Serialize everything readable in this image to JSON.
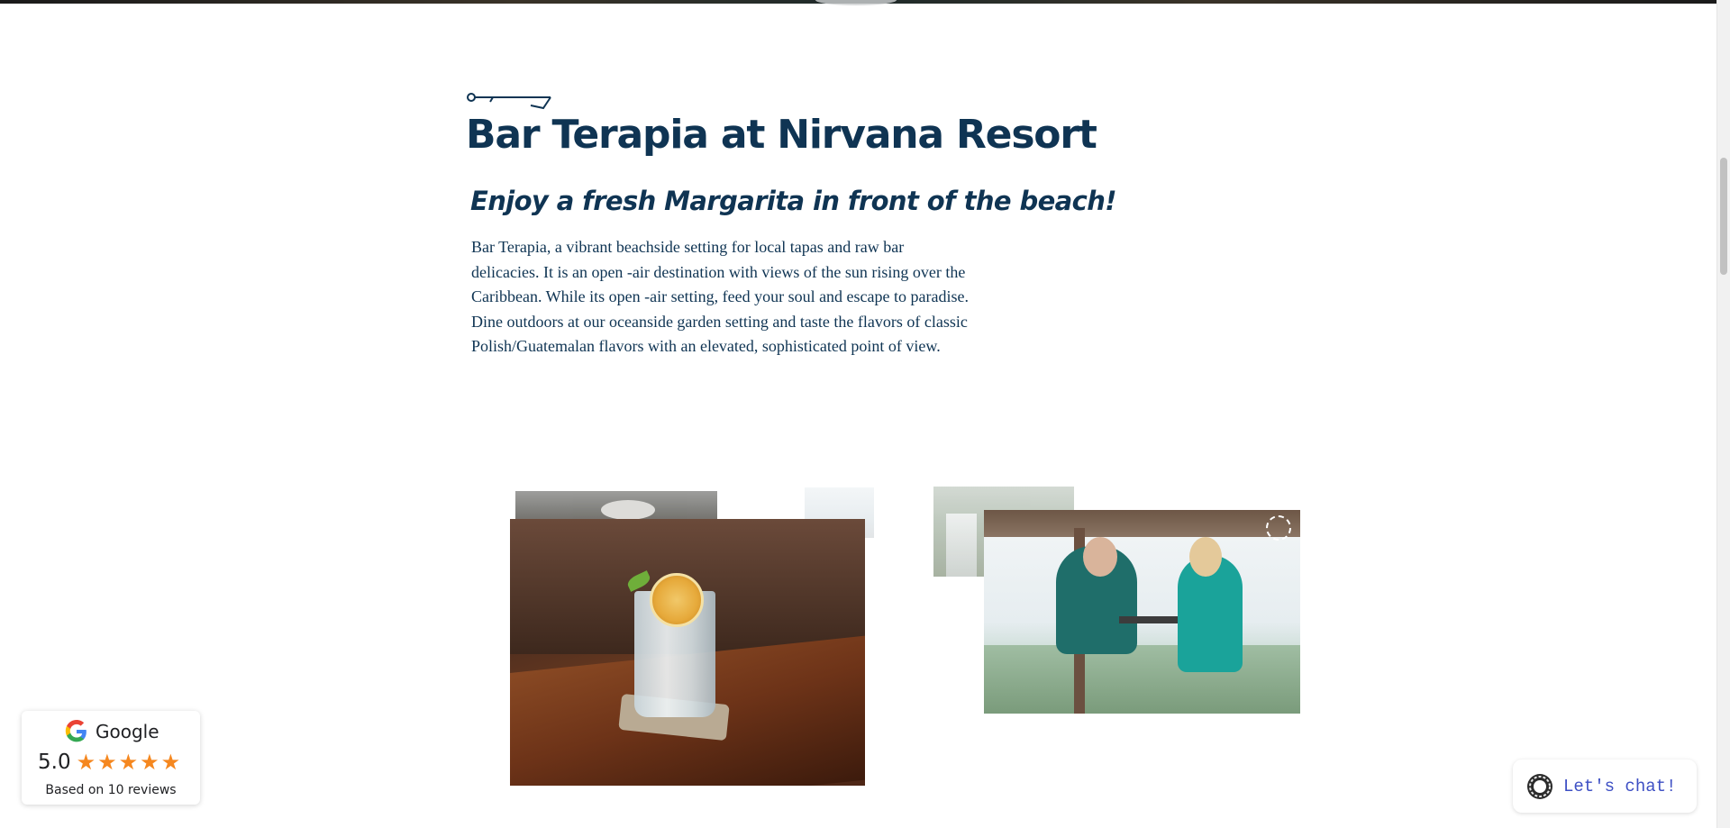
{
  "page": {
    "title": "Bar Terapia at Nirvana Resort",
    "subtitle": "Enjoy a fresh Margarita in front of  the beach!",
    "paragraphs": [
      "Bar Terapia, a vibrant beachside setting for local tapas and raw bar delicacies. It is an open -air destination with views of the sun rising over the Caribbean. While its open -air setting, feed your soul and escape to paradise.",
      "Dine outdoors at our oceanside garden setting and taste the flavors of classic Polish/Guatemalan flavors with an elevated, sophisticated point of view."
    ]
  },
  "google_widget": {
    "brand": "Google",
    "score": "5.0",
    "stars": 5,
    "reviews_text": "Based on 10 reviews"
  },
  "chat": {
    "label": "Let's chat!"
  },
  "colors": {
    "heading": "#0f3453",
    "star": "#f5871f",
    "chat_text": "#3d4fc4"
  },
  "icons": [
    "google-g-icon",
    "star-icon",
    "chat-logo-icon",
    "decorative-key-icon"
  ]
}
